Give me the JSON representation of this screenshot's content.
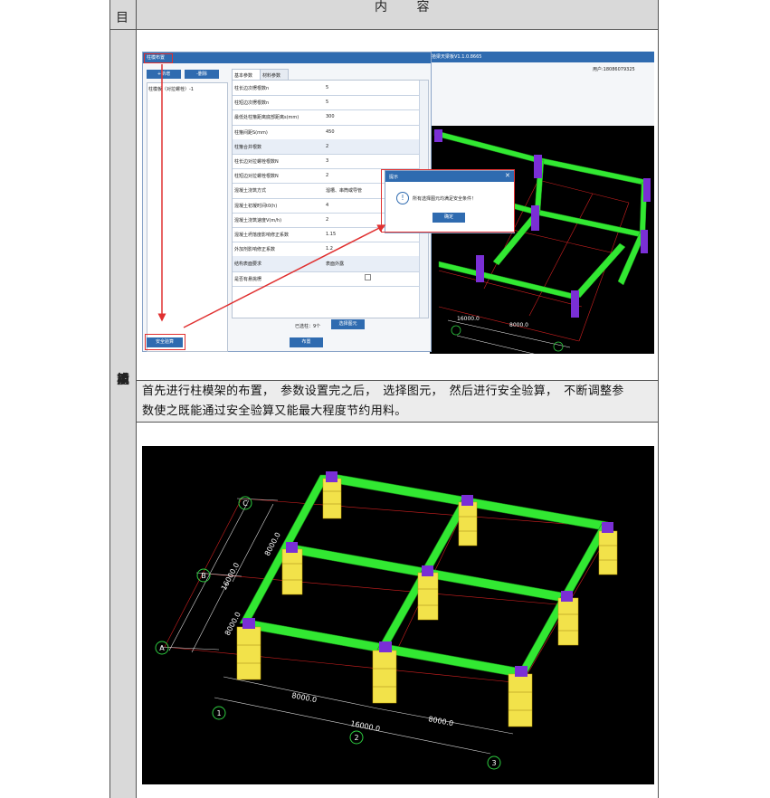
{
  "header": {
    "left_stub": "目",
    "content_title": "内 容"
  },
  "side_label": [
    "模",
    "板",
    "功",
    "能",
    "试",
    "用"
  ],
  "paragraph": {
    "line1": "首先进行柱模架的布置，　参数设置完之后，　选择图元，　然后进行安全验算，　不断调整参",
    "line2": "数使之既能通过安全验算又能最大程度节约用料。"
  },
  "dialog": {
    "title": "柱模布置",
    "main_title": "拾梁天梁板V1.1.0.8665",
    "user_label": "用户:18086079325",
    "add_button": "+新增",
    "delete_button": "-删除",
    "list_item": "柱模板（对拉螺栓）-1",
    "tabs": [
      "基本参数",
      "材料参数"
    ],
    "params": [
      {
        "k": "柱长边次楞根数n",
        "v": "5"
      },
      {
        "k": "柱短边次楞根数n",
        "v": "5"
      },
      {
        "k": "最低处柱箍距离底部距离s(mm)",
        "v": "300"
      },
      {
        "k": "柱箍间距S(mm)",
        "v": "450"
      },
      {
        "k": "柱箍合并根数",
        "v": "2"
      },
      {
        "k": "柱长边对拉螺栓根数N",
        "v": "3"
      },
      {
        "k": "柱短边对拉螺栓根数N",
        "v": "2"
      },
      {
        "k": "混凝土浇筑方式",
        "v": "溜槽、串筒或导管"
      },
      {
        "k": "混凝土初凝时间t0(h)",
        "v": "4"
      },
      {
        "k": "混凝土浇筑速度V(m/h)",
        "v": "2"
      },
      {
        "k": "混凝土坍落度影响修正系数",
        "v": "1.15"
      },
      {
        "k": "外加剂影响修正系数",
        "v": "1.2"
      },
      {
        "k": "结构表面要求",
        "v": "表面外露"
      },
      {
        "k": "是否有悬挑楞",
        "v": ""
      }
    ],
    "selected_count": "已选柱：9个",
    "select_button": "选择图元",
    "place_button": "布置",
    "check_button": "安全验算"
  },
  "prompt": {
    "title": "提示",
    "message": "所有选择图元均满足安全条件！",
    "ok_button": "确定"
  },
  "top_model_dims": {
    "d1": "16000.0",
    "d2": "8000.0"
  },
  "bottom_model": {
    "axes": [
      "C",
      "B",
      "A",
      "1",
      "2",
      "3"
    ],
    "dims": {
      "left_total": "16000.0",
      "left_a": "8000.0",
      "left_b": "8000.0",
      "bottom_total": "16000.0",
      "bottom_a": "8000.0",
      "bottom_b": "8000.0"
    }
  },
  "colors": {
    "beam": "#32e832",
    "column": "#7a2fd6",
    "formwork": "#f2e24a",
    "accent": "#2f6bb0",
    "highlight": "#e03030"
  }
}
